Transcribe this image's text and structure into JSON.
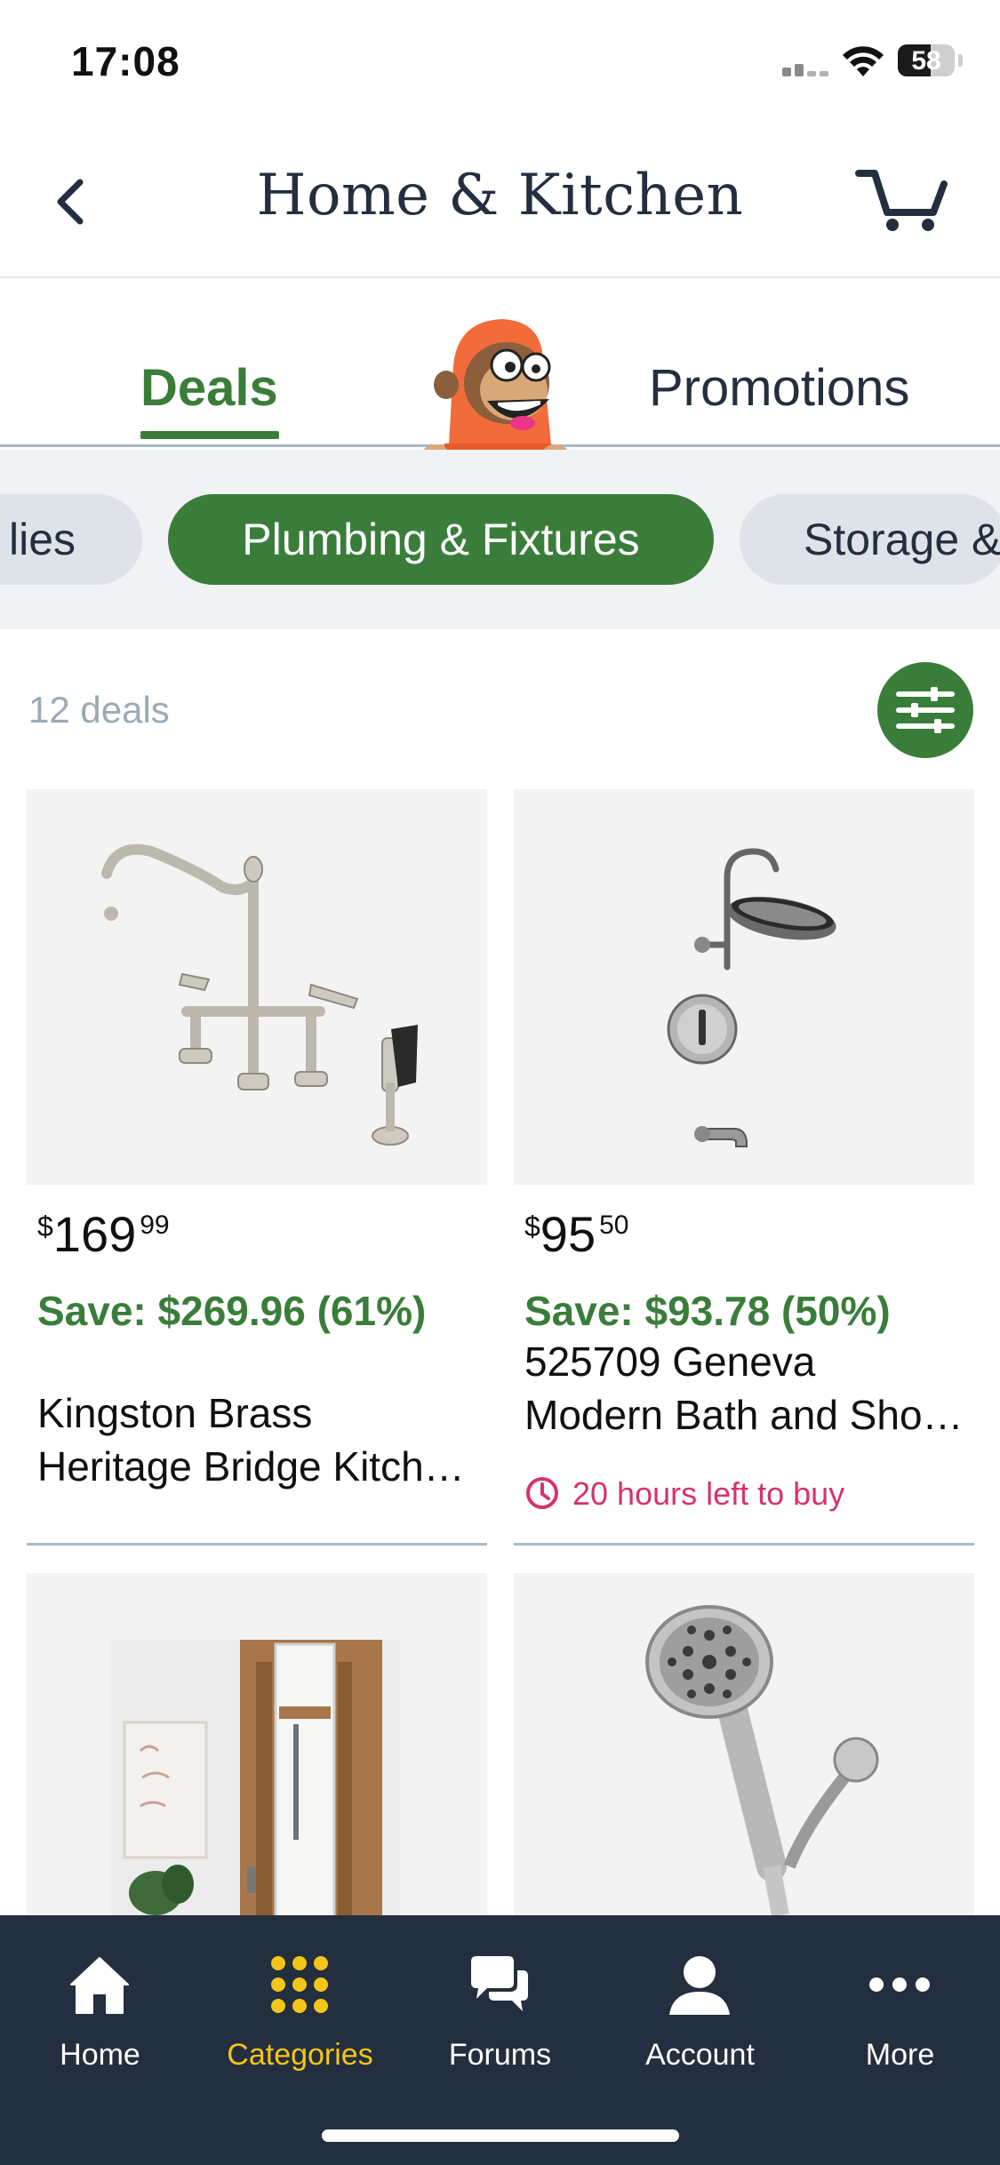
{
  "status_bar": {
    "time": "17:08",
    "battery": "58"
  },
  "header": {
    "title": "Home & Kitchen",
    "back_icon": "chevron-left-icon",
    "cart_icon": "cart-icon"
  },
  "tabs": {
    "deals": "Deals",
    "promotions": "Promotions",
    "active": "Deals"
  },
  "chips": {
    "prev": "lies",
    "active": "Plumbing & Fixtures",
    "next": "Storage &"
  },
  "deals": {
    "count_label": "12 deals",
    "filter_icon": "sliders-icon"
  },
  "products": [
    {
      "currency": "$",
      "price_whole": "169",
      "price_fraction": "99",
      "save": "Save: $269.96 (61%)",
      "title_line1": "Kingston Brass",
      "title_line2": "Heritage Bridge Kitchen Faucet",
      "timer": ""
    },
    {
      "currency": "$",
      "price_whole": "95",
      "price_fraction": "50",
      "save": "Save: $93.78 (50%)",
      "title_line1": "525709 Geneva",
      "title_line2": "Modern Bath and Shower",
      "timer": "20 hours left to buy"
    }
  ],
  "colors": {
    "brand_green": "#3a7d3a",
    "navy": "#232f3e",
    "timer_pink": "#d6336c",
    "active_yellow": "#f5c518"
  },
  "tabbar": {
    "items": [
      {
        "label": "Home",
        "icon": "home-icon"
      },
      {
        "label": "Categories",
        "icon": "grid-dots-icon"
      },
      {
        "label": "Forums",
        "icon": "chat-bubbles-icon"
      },
      {
        "label": "Account",
        "icon": "person-icon"
      },
      {
        "label": "More",
        "icon": "ellipsis-icon"
      }
    ],
    "active": "Categories"
  }
}
